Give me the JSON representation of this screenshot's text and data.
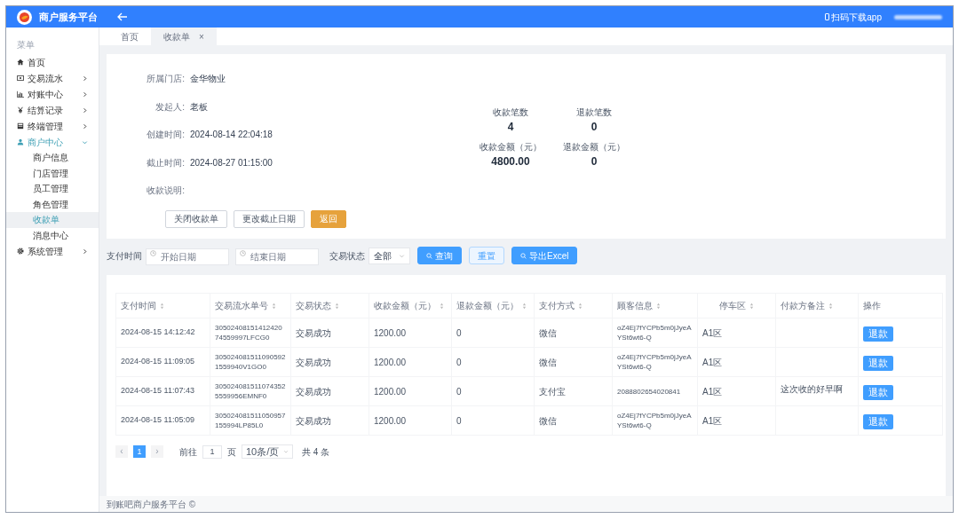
{
  "header": {
    "title": "商户服务平台",
    "download": "扫码下载app"
  },
  "sidebar": {
    "heading": "菜单",
    "items": [
      {
        "label": "首页",
        "expanded": false,
        "selected": false,
        "has_arrow": false
      },
      {
        "label": "交易流水",
        "expanded": false,
        "selected": false,
        "has_arrow": true
      },
      {
        "label": "对账中心",
        "expanded": false,
        "selected": false,
        "has_arrow": true
      },
      {
        "label": "结算记录",
        "expanded": false,
        "selected": false,
        "has_arrow": true
      },
      {
        "label": "终端管理",
        "expanded": false,
        "selected": false,
        "has_arrow": true
      },
      {
        "label": "商户中心",
        "expanded": true,
        "selected": false,
        "has_arrow": true,
        "children": [
          {
            "label": "商户信息",
            "selected": false
          },
          {
            "label": "门店管理",
            "selected": false
          },
          {
            "label": "员工管理",
            "selected": false
          },
          {
            "label": "角色管理",
            "selected": false
          },
          {
            "label": "收款单",
            "selected": true
          },
          {
            "label": "消息中心",
            "selected": false
          }
        ]
      },
      {
        "label": "系统管理",
        "expanded": false,
        "selected": false,
        "has_arrow": true
      }
    ]
  },
  "tabs": [
    {
      "label": "首页",
      "selected": false,
      "closable": false
    },
    {
      "label": "收款单",
      "selected": true,
      "closable": true,
      "close": "×"
    }
  ],
  "detail": {
    "fields": [
      {
        "label": "所属门店:",
        "value": "金华物业"
      },
      {
        "label": "发起人:",
        "value": "老板"
      },
      {
        "label": "创建时间:",
        "value": "2024-08-14 22:04:18"
      },
      {
        "label": "截止时间:",
        "value": "2024-08-27 01:15:00"
      },
      {
        "label": "收款说明:"
      }
    ],
    "stats": [
      {
        "label": "收款笔数",
        "value": "4"
      },
      {
        "label": "退款笔数",
        "value": "0"
      },
      {
        "label": "收款金额（元）",
        "value": "4800.00"
      },
      {
        "label": "退款金额（元）",
        "value": "0"
      }
    ],
    "buttons": [
      {
        "label": "关闭收款单",
        "kind": "plain"
      },
      {
        "label": "更改截止日期",
        "kind": "plain"
      },
      {
        "label": "返回",
        "kind": "warning"
      }
    ]
  },
  "filter": {
    "label": "支付时间",
    "start_placeholder": "开始日期",
    "end_placeholder": "结束日期",
    "status_label": "交易状态",
    "status_value": "全部",
    "buttons": [
      {
        "label": "查询",
        "kind": "primary",
        "icon": true
      },
      {
        "label": "重置",
        "kind": "light",
        "icon": false
      },
      {
        "label": "导出Excel",
        "kind": "primary",
        "icon": true
      }
    ]
  },
  "table": {
    "columns": [
      {
        "label": "支付时间",
        "sortable": true
      },
      {
        "label": "交易流水单号",
        "sortable": true
      },
      {
        "label": "交易状态",
        "sortable": true
      },
      {
        "label": "收款金额（元）",
        "sortable": true
      },
      {
        "label": "退款金额（元）",
        "sortable": true
      },
      {
        "label": "支付方式",
        "sortable": true
      },
      {
        "label": "顾客信息",
        "sortable": true
      },
      {
        "label": "停车区",
        "sortable": true
      },
      {
        "label": "付款方备注",
        "sortable": true
      },
      {
        "label": "操作",
        "sortable": false
      }
    ],
    "rows": [
      {
        "cells": [
          "2024-08-15 14:12:42",
          "3050240815141242074559997LFCG0",
          "交易成功",
          "1200.00",
          "0",
          "微信",
          "oZ4Ej7fYCPb5m0jJyeAYSt6wt6-Q",
          "A1区",
          ""
        ],
        "action": "退款"
      },
      {
        "cells": [
          "2024-08-15 11:09:05",
          "3050240815110905921559940V1GO0",
          "交易成功",
          "1200.00",
          "0",
          "微信",
          "oZ4Ej7fYCPb5m0jJyeAYSt6wt6-Q",
          "A1区",
          ""
        ],
        "action": "退款"
      },
      {
        "cells": [
          "2024-08-15 11:07:43",
          "3050240815110743525559956EMNF0",
          "交易成功",
          "1200.00",
          "0",
          "支付宝",
          "2088802654020841",
          "A1区",
          "这次收的好早啊"
        ],
        "action": "退款"
      },
      {
        "cells": [
          "2024-08-15 11:05:09",
          "305024081511050957155994LP85L0",
          "交易成功",
          "1200.00",
          "0",
          "微信",
          "oZ4Ej7fYCPb5m0jJyeAYSt6wt6-Q",
          "A1区",
          ""
        ],
        "action": "退款"
      }
    ]
  },
  "pagination": {
    "prev": "‹",
    "pages": [
      {
        "label": "1",
        "selected": true
      }
    ],
    "next": "›",
    "goto": "前往",
    "goto_value": "1",
    "page_unit": "页",
    "page_size": "10条/页",
    "total": "共 4 条"
  },
  "footer": "到账吧商户服务平台 ©"
}
